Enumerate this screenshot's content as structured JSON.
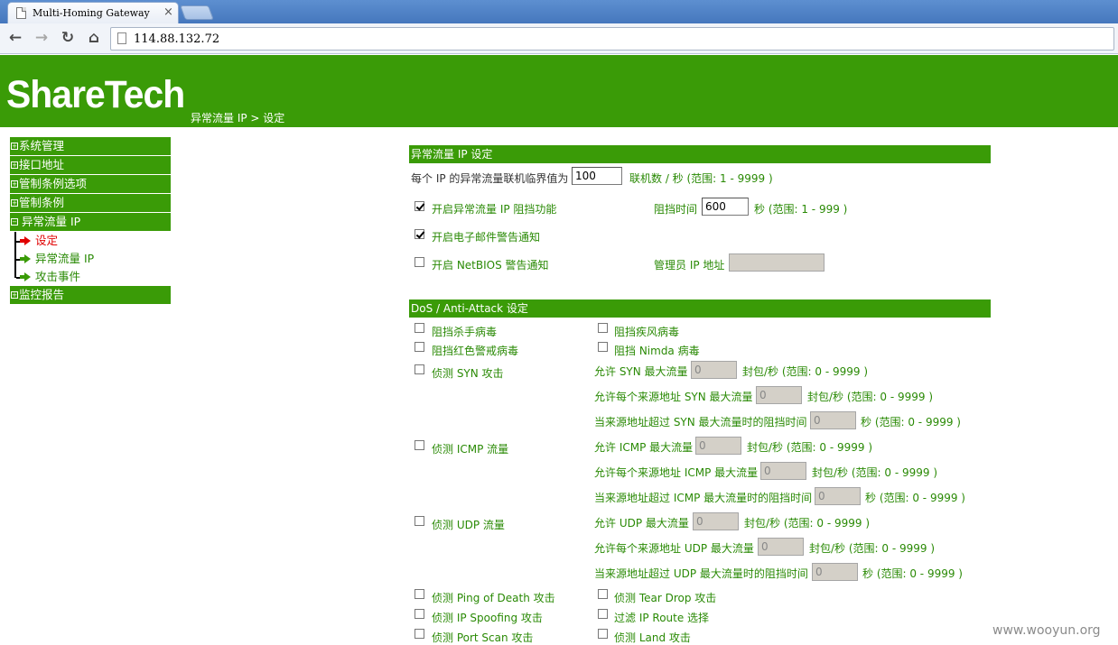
{
  "browser": {
    "tab_title": "Multi-Homing Gateway",
    "tab_close": "×",
    "back_icon": "←",
    "forward_icon": "→",
    "reload_icon": "↻",
    "home_icon": "⌂",
    "url": "114.88.132.72"
  },
  "header": {
    "logo": "ShareTech",
    "breadcrumb": "异常流量 IP > 设定",
    "color": "#3a9b07"
  },
  "sidebar": {
    "system": "系统管理",
    "interface": "接口地址",
    "policy_options": "管制条例选项",
    "policy": "管制条例",
    "abnormal_ip": "异常流量 IP",
    "sub_settings": "设定",
    "sub_abnormal_ip": "异常流量 IP",
    "sub_attack_events": "攻击事件",
    "monitor": "监控报告",
    "plus_mark": "+",
    "minus_mark": "−"
  },
  "section1": {
    "title": "异常流量 IP 设定",
    "threshold_label": "每个 IP 的异常流量联机临界值为",
    "threshold_value": "100",
    "threshold_unit": "联机数 / 秒 (范围: 1 - 9999 )",
    "enable_block": "开启异常流量 IP 阻挡功能",
    "enable_block_checked": true,
    "block_time_label": "阻挡时间",
    "block_time_value": "600",
    "block_time_unit": "秒 (范围: 1 - 999 )",
    "email_alert": "开启电子邮件警告通知",
    "email_alert_checked": true,
    "netbios_alert": "开启 NetBIOS 警告通知",
    "netbios_alert_checked": false,
    "admin_ip_label": "管理员 IP 地址",
    "admin_ip_value": ""
  },
  "section2": {
    "title": "DoS / Anti-Attack 设定",
    "block_killer": "阻挡杀手病毒",
    "block_storm": "阻挡疾风病毒",
    "block_redalert": "阻挡红色警戒病毒",
    "block_nimda": "阻挡 Nimda 病毒",
    "syn_detect": "侦测 SYN 攻击",
    "syn_max": "允许 SYN 最大流量",
    "syn_max_val": "0",
    "syn_src_max": "允许每个来源地址 SYN 最大流量",
    "syn_src_max_val": "0",
    "syn_block": "当来源地址超过 SYN 最大流量时的阻挡时间",
    "syn_block_val": "0",
    "icmp_detect": "侦测 ICMP 流量",
    "icmp_max": "允许 ICMP 最大流量",
    "icmp_max_val": "0",
    "icmp_src_max": "允许每个来源地址 ICMP 最大流量",
    "icmp_src_max_val": "0",
    "icmp_block": "当来源地址超过 ICMP 最大流量时的阻挡时间",
    "icmp_block_val": "0",
    "udp_detect": "侦测 UDP 流量",
    "udp_max": "允许 UDP 最大流量",
    "udp_max_val": "0",
    "udp_src_max": "允许每个来源地址 UDP 最大流量",
    "udp_src_max_val": "0",
    "udp_block": "当来源地址超过 UDP 最大流量时的阻挡时间",
    "udp_block_val": "0",
    "pkt_unit": "封包/秒 (范围: 0 - 9999 )",
    "sec_unit": "秒 (范围: 0 - 9999 )",
    "ping_of_death": "侦测 Ping of Death 攻击",
    "tear_drop": "侦测 Tear Drop 攻击",
    "ip_spoofing": "侦测 IP Spoofing 攻击",
    "ip_route": "过滤 IP Route 选择",
    "port_scan": "侦测 Port Scan 攻击",
    "land": "侦测 Land 攻击"
  },
  "watermark": "www.wooyun.org"
}
